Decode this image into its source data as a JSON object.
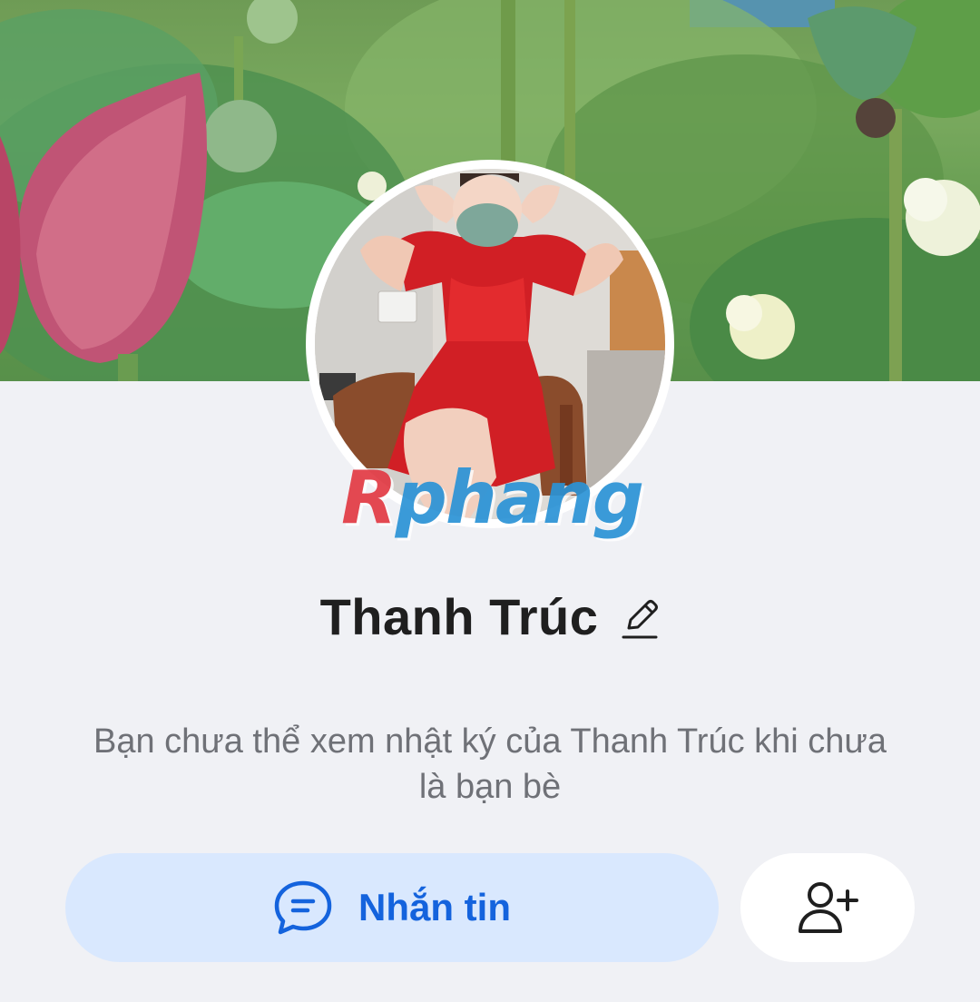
{
  "profile": {
    "name": "Thanh Trúc",
    "notice": "Bạn chưa thể xem nhật ký của Thanh Trúc khi chưa là bạn bè"
  },
  "watermark": {
    "first": "R",
    "rest": "phang"
  },
  "actions": {
    "message_label": "Nhắn tin"
  },
  "icons": {
    "edit": "pencil-icon",
    "message": "chat-bubble-icon",
    "add_friend": "add-friend-icon"
  },
  "colors": {
    "background": "#f0f1f5",
    "accent": "#1463dd",
    "message_button_bg": "#d9e8fe",
    "name_text": "#1f1f1f",
    "notice_text": "#6f7177"
  }
}
